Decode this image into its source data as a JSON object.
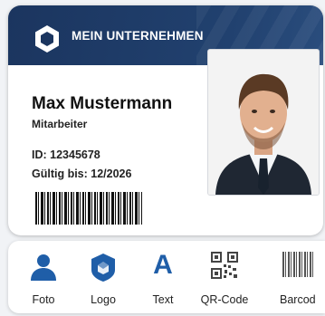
{
  "card": {
    "company": "MEIN UNTERNEHMEN",
    "name": "Max Mustermann",
    "role": "Mitarbeiter",
    "id_line": "ID: 12345678",
    "valid_line": "Gültig bis: 12/2026"
  },
  "toolbar": {
    "items": [
      {
        "label": "Foto",
        "icon": "person-icon"
      },
      {
        "label": "Logo",
        "icon": "logo-shield-icon"
      },
      {
        "label": "Text",
        "icon": "text-icon",
        "glyph": "A"
      },
      {
        "label": "QR-Code",
        "icon": "qr-code-icon"
      },
      {
        "label": "Barcod",
        "icon": "barcode-icon"
      }
    ]
  },
  "colors": {
    "header": "#1b355f",
    "accent": "#1f5ea8"
  }
}
